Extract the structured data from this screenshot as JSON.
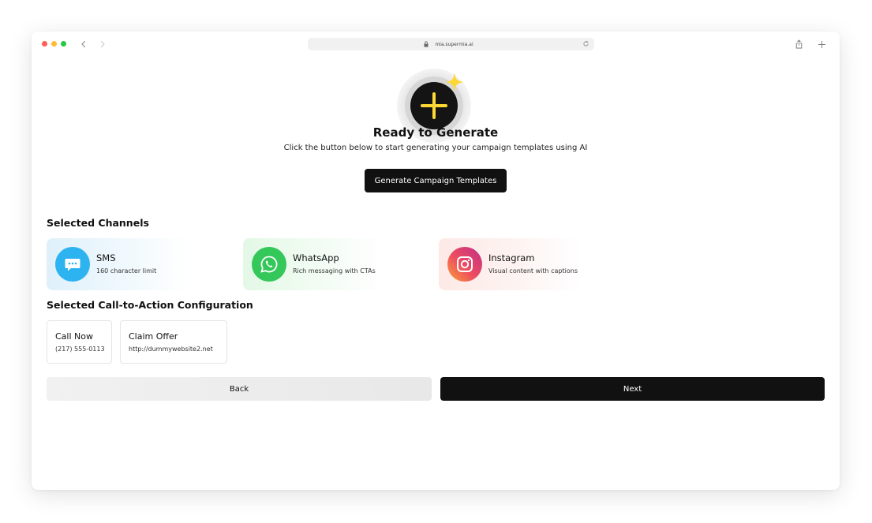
{
  "browser": {
    "url": "mia.supermia.ai"
  },
  "hero": {
    "title": "Ready to Generate",
    "subtitle": "Click the button below to start generating your campaign templates using AI",
    "generate_label": "Generate Campaign Templates",
    "accent_color": "#fdd835"
  },
  "channels_section": {
    "title": "Selected Channels",
    "items": [
      {
        "name": "SMS",
        "desc": "160 character limit",
        "icon": "chat-bubble-icon",
        "color": "#2db3f0"
      },
      {
        "name": "WhatsApp",
        "desc": "Rich messaging with CTAs",
        "icon": "whatsapp-icon",
        "color": "#34c759"
      },
      {
        "name": "Instagram",
        "desc": "Visual content with captions",
        "icon": "instagram-icon",
        "color": "#e1306c"
      }
    ]
  },
  "cta_section": {
    "title": "Selected Call-to-Action Configuration",
    "items": [
      {
        "name": "Call Now",
        "value": "(217) 555-0113"
      },
      {
        "name": "Claim Offer",
        "value": "http://dummywebsite2.net"
      }
    ]
  },
  "footer": {
    "back_label": "Back",
    "next_label": "Next"
  }
}
